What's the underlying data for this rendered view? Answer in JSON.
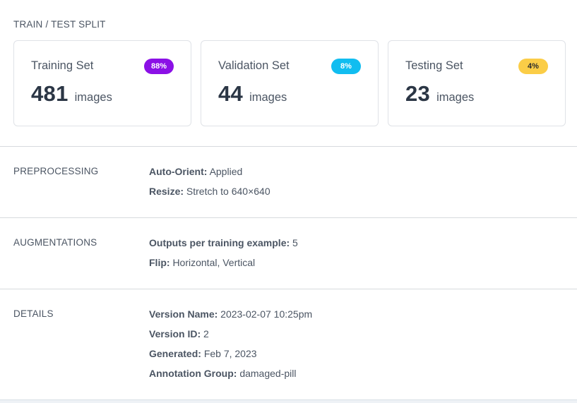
{
  "split": {
    "title": "TRAIN / TEST SPLIT",
    "cards": [
      {
        "label": "Training Set",
        "count": "481",
        "unit": "images",
        "percent": "88%"
      },
      {
        "label": "Validation Set",
        "count": "44",
        "unit": "images",
        "percent": "8%"
      },
      {
        "label": "Testing Set",
        "count": "23",
        "unit": "images",
        "percent": "4%"
      }
    ]
  },
  "preprocessing": {
    "label": "PREPROCESSING",
    "rows": [
      {
        "key": "Auto-Orient:",
        "value": "Applied"
      },
      {
        "key": "Resize:",
        "value": "Stretch to 640×640"
      }
    ]
  },
  "augmentations": {
    "label": "AUGMENTATIONS",
    "rows": [
      {
        "key": "Outputs per training example:",
        "value": "5"
      },
      {
        "key": "Flip:",
        "value": "Horizontal, Vertical"
      }
    ]
  },
  "details": {
    "label": "DETAILS",
    "rows": [
      {
        "key": "Version Name:",
        "value": "2023-02-07 10:25pm"
      },
      {
        "key": "Version ID:",
        "value": "2"
      },
      {
        "key": "Generated:",
        "value": "Feb 7, 2023"
      },
      {
        "key": "Annotation Group:",
        "value": "damaged-pill"
      }
    ]
  },
  "colors": {
    "training_badge": "#8b10e6",
    "validation_badge": "#11bdf0",
    "testing_badge": "#fbcd47"
  }
}
